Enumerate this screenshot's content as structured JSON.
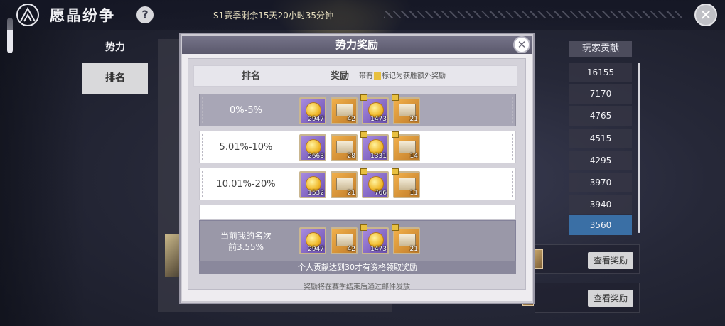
{
  "header": {
    "title": "愿晶纷争",
    "help_icon": "?",
    "season_text": "S1赛季剩余15天20小时35分钟",
    "close_glyph": "✕"
  },
  "left_tabs": [
    {
      "label": "势力"
    },
    {
      "label": "排名"
    }
  ],
  "ranking_list": {
    "header": "玩家贡献",
    "values": [
      "16155",
      "7170",
      "4765",
      "4515",
      "4295",
      "3970",
      "3940",
      "3560"
    ],
    "selected_index": 7,
    "view_button_label": "查看奖励"
  },
  "modal": {
    "title": "势力奖励",
    "close_glyph": "✕",
    "column_rank": "排名",
    "column_reward": "奖励",
    "note_prefix": "带有",
    "note_suffix": "标记为获胜额外奖励",
    "rows": [
      {
        "label": "0%-5%",
        "highlighted": true,
        "items": [
          {
            "type": "coin",
            "count": "2947",
            "bonus": false
          },
          {
            "type": "chest",
            "count": "42",
            "bonus": false
          },
          {
            "type": "coin",
            "count": "1473",
            "bonus": true
          },
          {
            "type": "chest",
            "count": "21",
            "bonus": true
          }
        ]
      },
      {
        "label": "5.01%-10%",
        "highlighted": false,
        "items": [
          {
            "type": "coin",
            "count": "2663",
            "bonus": false
          },
          {
            "type": "chest",
            "count": "28",
            "bonus": false
          },
          {
            "type": "coin",
            "count": "1331",
            "bonus": true
          },
          {
            "type": "chest",
            "count": "14",
            "bonus": true
          }
        ]
      },
      {
        "label": "10.01%-20%",
        "highlighted": false,
        "items": [
          {
            "type": "coin",
            "count": "1532",
            "bonus": false
          },
          {
            "type": "chest",
            "count": "21",
            "bonus": false
          },
          {
            "type": "coin",
            "count": "766",
            "bonus": true
          },
          {
            "type": "chest",
            "count": "11",
            "bonus": true
          }
        ]
      }
    ],
    "my_rank": {
      "line1": "当前我的名次",
      "line2": "前3.55%",
      "items": [
        {
          "type": "coin",
          "count": "2947",
          "bonus": false
        },
        {
          "type": "chest",
          "count": "42",
          "bonus": false
        },
        {
          "type": "coin",
          "count": "1473",
          "bonus": true
        },
        {
          "type": "chest",
          "count": "21",
          "bonus": true
        }
      ]
    },
    "condition_text": "个人贡献达到30才有资格领取奖励",
    "footer_note": "奖励将在赛季结束后通过邮件发放"
  }
}
